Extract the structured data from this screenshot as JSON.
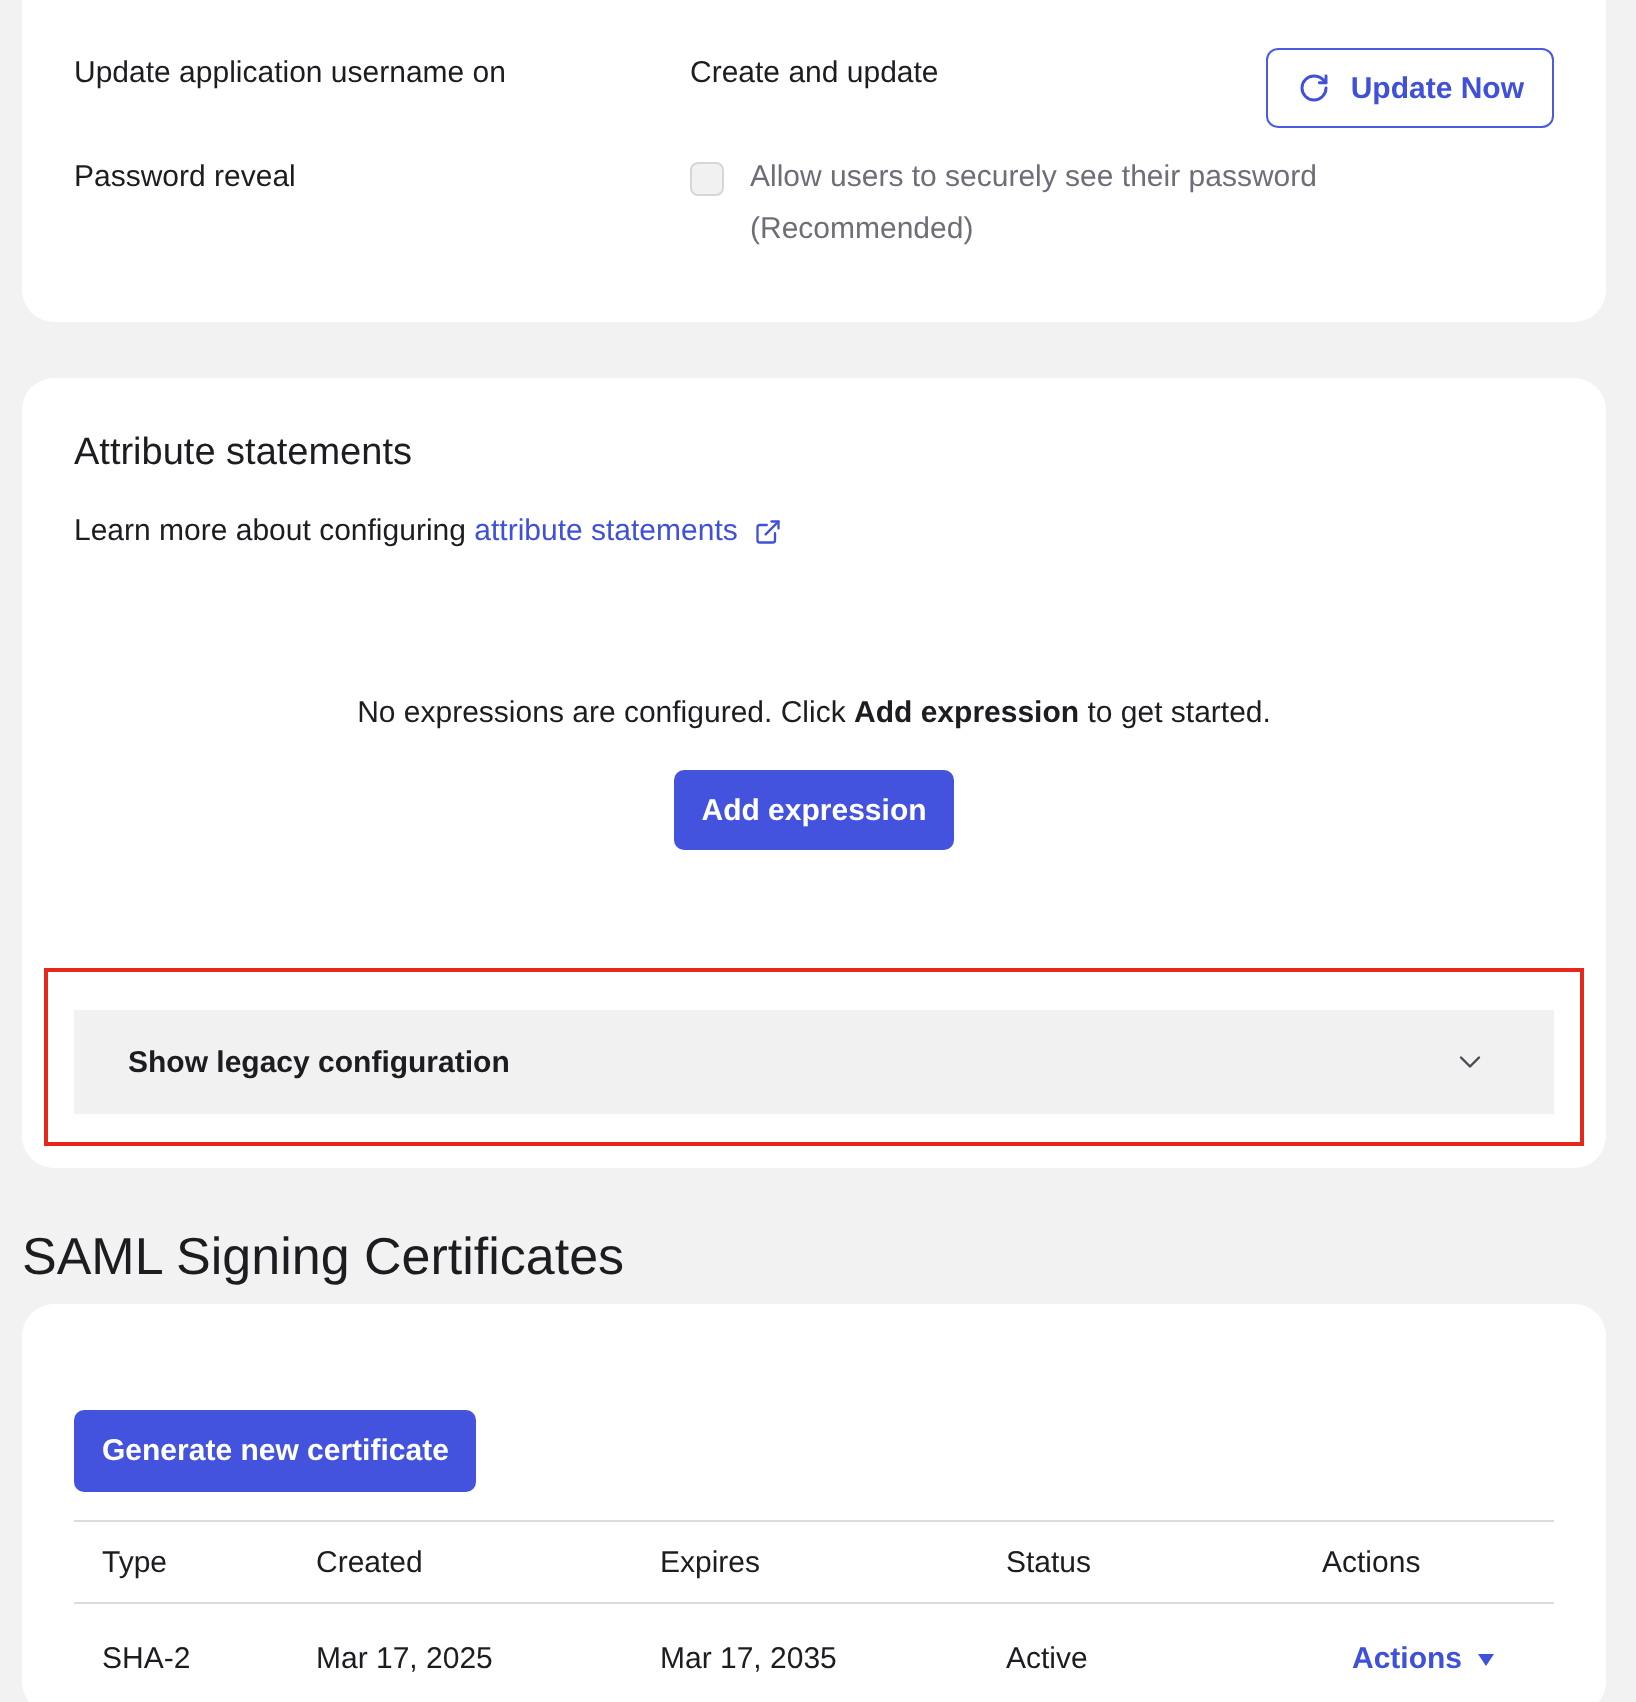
{
  "username_settings": {
    "rows": [
      {
        "kind": "value",
        "label": "Update application username on",
        "value": "Create and update",
        "button": "Update Now"
      },
      {
        "kind": "checkbox",
        "label": "Password reveal",
        "option": "Allow users to securely see their password (Recommended)",
        "checked": false,
        "disabled": true
      }
    ]
  },
  "attribute_statements": {
    "title": "Attribute statements",
    "learn_more": "Learn more about configuring",
    "link": "attribute statements",
    "empty_message": "No expressions are configured. Click **Add expression** to get started.",
    "add_button": "Add expression",
    "legacy": {
      "label": "Show legacy configuration",
      "expanded": false,
      "highlighted": true
    }
  },
  "certificates": {
    "title": "SAML Signing Certificates",
    "generate_button": "Generate new certificate",
    "columns": [
      "Type",
      "Created",
      "Expires",
      "Status",
      "Actions"
    ],
    "rows": [
      {
        "cells": [
          "SHA-2",
          "Mar 17, 2025",
          "Mar 17, 2035",
          "Active"
        ],
        "action": "Actions"
      }
    ]
  }
}
